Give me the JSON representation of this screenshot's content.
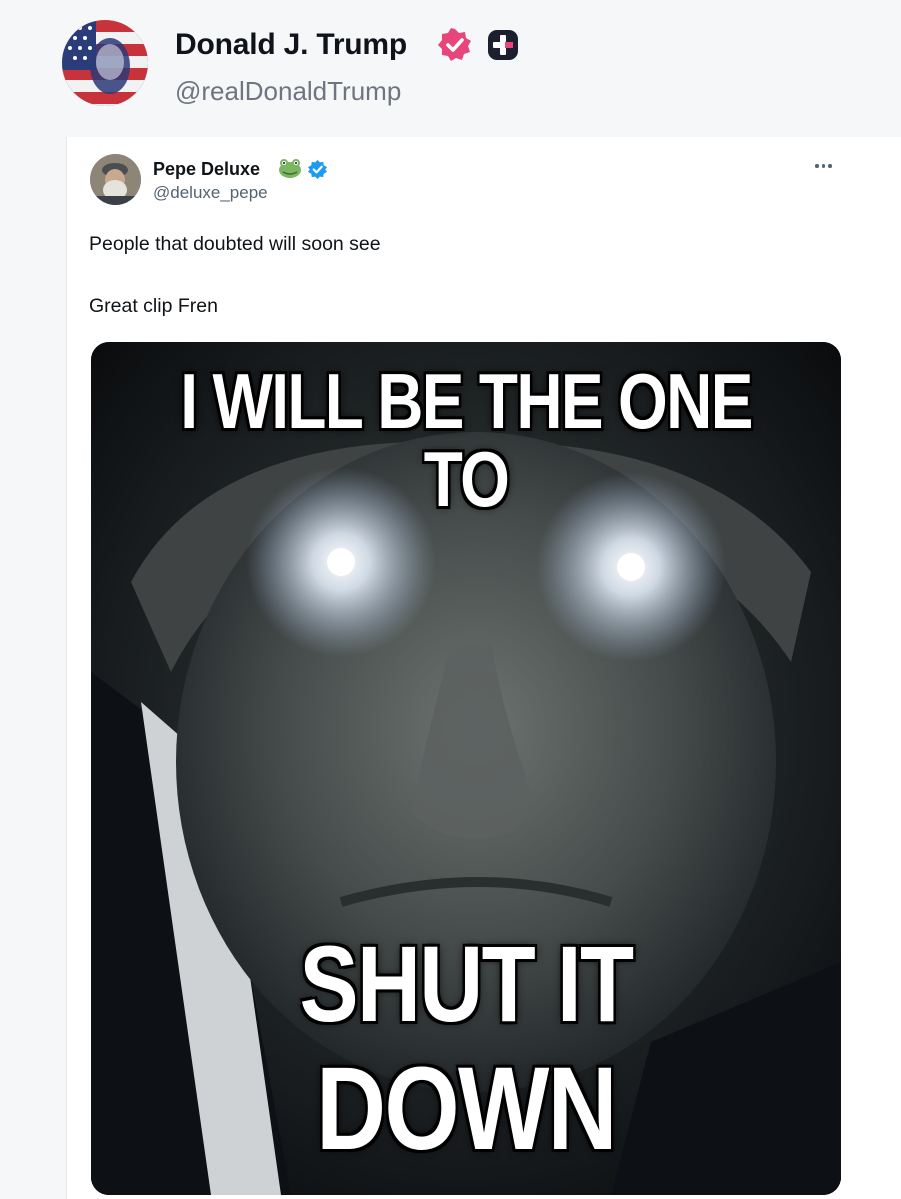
{
  "post": {
    "author_name": "Donald J. Trump",
    "author_handle": "@realDonaldTrump",
    "verified_icon": "verified-badge-icon",
    "extra_badge_icon": "plus-badge-icon"
  },
  "quoted_post": {
    "author_name": "Pepe Deluxe",
    "author_handle": "@deluxe_pepe",
    "name_emoji": "frog-emoji",
    "more_icon": "more-options-icon",
    "lines": [
      "People that doubted will soon see",
      "Great clip Fren"
    ],
    "image": {
      "caption_top": "I WILL BE THE ONE TO",
      "caption_bottom_line1": "SHUT IT",
      "caption_bottom_line2": "DOWN"
    }
  },
  "colors": {
    "pink_badge": "#e8457a",
    "blue_badge": "#1d9bf0",
    "handle_gray": "#6f7480"
  }
}
